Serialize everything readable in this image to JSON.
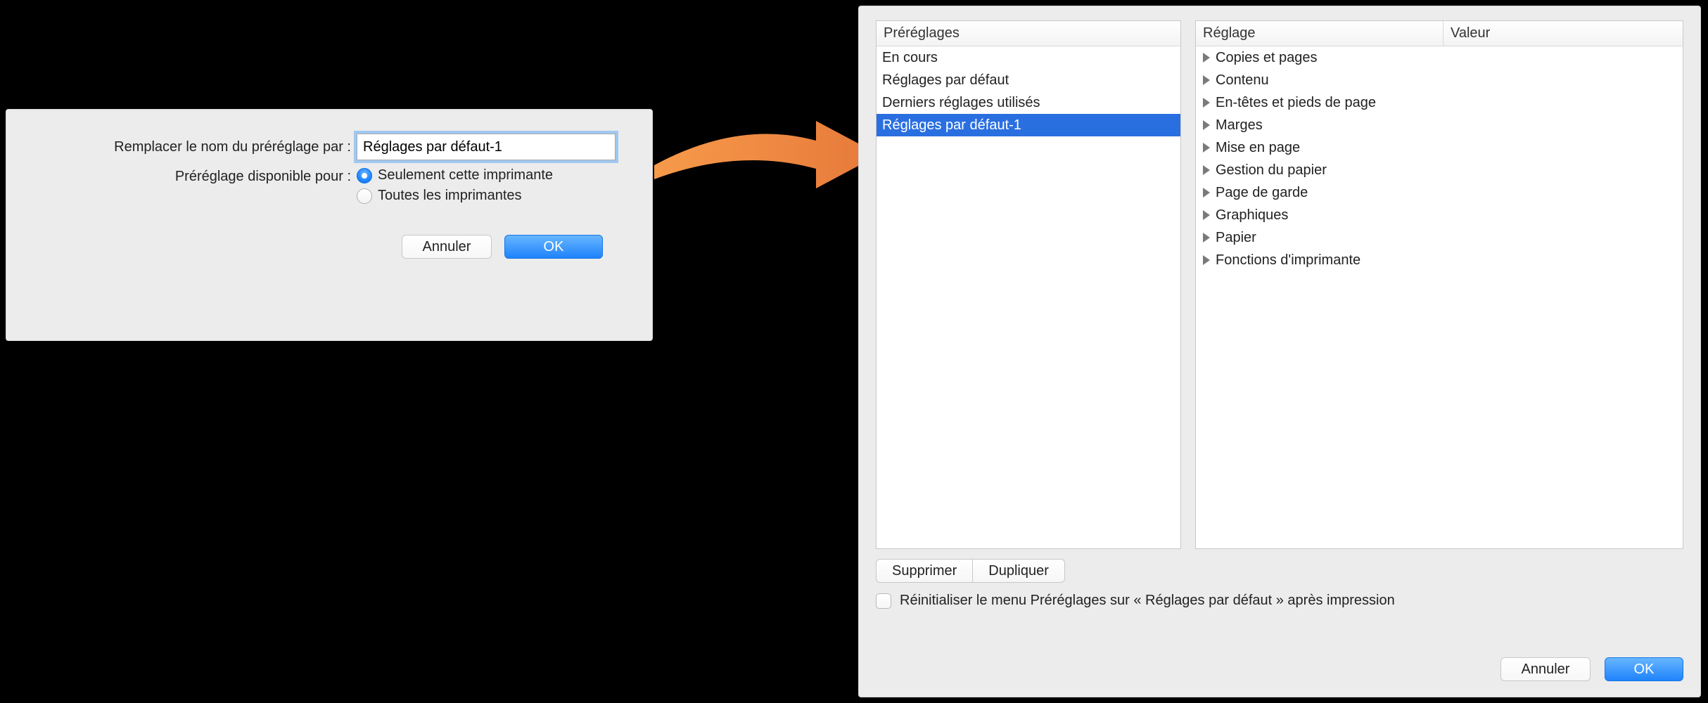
{
  "left_dialog": {
    "name_label": "Remplacer le nom du préréglage par :",
    "name_value": "Réglages par défaut-1",
    "avail_label": "Préréglage disponible pour :",
    "radio_only_this": "Seulement cette imprimante",
    "radio_all": "Toutes les imprimantes",
    "cancel": "Annuler",
    "ok": "OK"
  },
  "right_dialog": {
    "presets_header": "Préréglages",
    "reglage_header": "Réglage",
    "valeur_header": "Valeur",
    "presets": [
      {
        "label": "En cours",
        "selected": false
      },
      {
        "label": "Réglages par défaut",
        "selected": false
      },
      {
        "label": "Derniers réglages utilisés",
        "selected": false
      },
      {
        "label": "Réglages par défaut-1",
        "selected": true
      }
    ],
    "settings_tree": [
      "Copies et pages",
      "Contenu",
      "En-têtes et pieds de page",
      "Marges",
      "Mise en page",
      "Gestion du papier",
      "Page de garde",
      "Graphiques",
      "Papier",
      "Fonctions d'imprimante"
    ],
    "delete": "Supprimer",
    "duplicate": "Dupliquer",
    "reset_label": "Réinitialiser le menu Préréglages sur « Réglages par défaut » après impression",
    "cancel": "Annuler",
    "ok": "OK"
  }
}
